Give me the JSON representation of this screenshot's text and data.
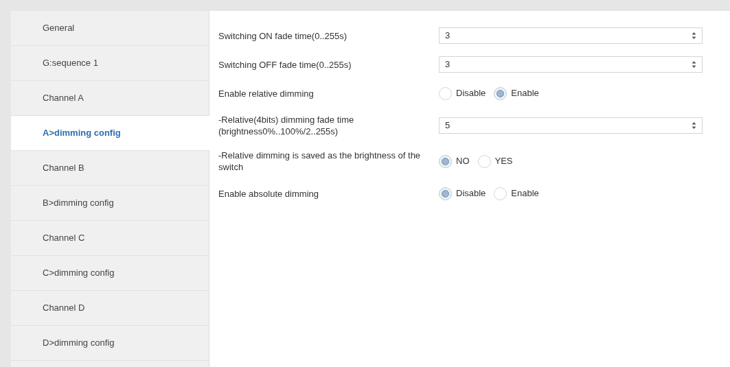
{
  "sidebar": {
    "items": [
      {
        "label": "General",
        "selected": false
      },
      {
        "label": "G:sequence 1",
        "selected": false
      },
      {
        "label": "Channel A",
        "selected": false
      },
      {
        "label": "A>dimming config",
        "selected": true
      },
      {
        "label": "Channel B",
        "selected": false
      },
      {
        "label": "B>dimming config",
        "selected": false
      },
      {
        "label": "Channel C",
        "selected": false
      },
      {
        "label": "C>dimming config",
        "selected": false
      },
      {
        "label": "Channel D",
        "selected": false
      },
      {
        "label": "D>dimming config",
        "selected": false
      }
    ]
  },
  "parameters": [
    {
      "kind": "spin",
      "label": "Switching ON fade time(0..255s)",
      "value": "3"
    },
    {
      "kind": "spin",
      "label": "Switching OFF fade time(0..255s)",
      "value": "3"
    },
    {
      "kind": "radio",
      "label": "Enable relative dimming",
      "options": [
        {
          "label": "Disable",
          "selected": false
        },
        {
          "label": "Enable",
          "selected": true
        }
      ]
    },
    {
      "kind": "spin",
      "label": "-Relative(4bits) dimming fade time (brightness0%..100%/2..255s)",
      "value": "5"
    },
    {
      "kind": "radio",
      "label": "-Relative dimming is saved as the brightness of the switch",
      "options": [
        {
          "label": "NO",
          "selected": true
        },
        {
          "label": "YES",
          "selected": false
        }
      ]
    },
    {
      "kind": "radio",
      "label": "Enable absolute dimming",
      "options": [
        {
          "label": "Disable",
          "selected": true
        },
        {
          "label": "Enable",
          "selected": false
        }
      ]
    }
  ]
}
